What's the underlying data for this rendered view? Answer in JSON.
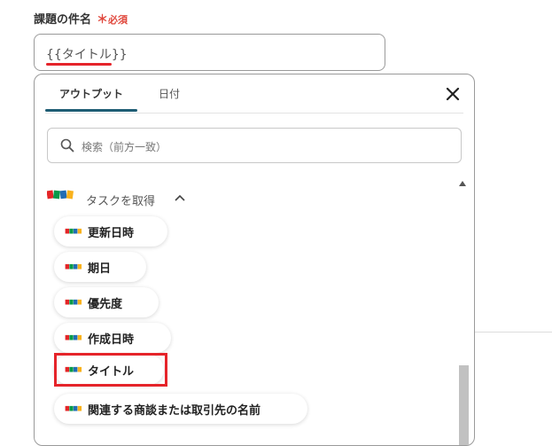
{
  "field": {
    "label": "課題の件名",
    "required_star": "＊",
    "required_text": "必須",
    "value": "{{タイトル}}"
  },
  "panel": {
    "tabs": [
      {
        "label": "アウトプット",
        "active": true
      },
      {
        "label": "日付",
        "active": false
      }
    ],
    "close_icon": "close-icon",
    "search_placeholder": "検索（前方一致）",
    "group": {
      "title": "タスクを取得",
      "logo": "zoho-logo",
      "expanded": true
    },
    "items": [
      {
        "label": "更新日時"
      },
      {
        "label": "期日"
      },
      {
        "label": "優先度"
      },
      {
        "label": "作成日時"
      },
      {
        "label": "タイトル",
        "highlighted": true
      },
      {
        "label": "関連する商談または取引先の名前"
      }
    ]
  },
  "colors": {
    "highlight": "#e5242a",
    "tab_indicator": "#1f5d74",
    "required": "#e0473c"
  }
}
